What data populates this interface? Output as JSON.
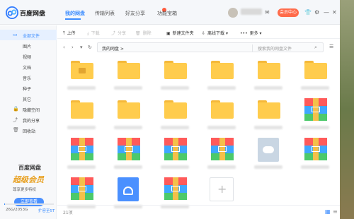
{
  "titlebar": {
    "brand": "百度网盘",
    "tabs": [
      {
        "label": "我的网盘",
        "active": true
      },
      {
        "label": "传输列表",
        "active": false
      },
      {
        "label": "好友分享",
        "active": false
      },
      {
        "label": "功能宝箱",
        "active": false
      }
    ],
    "member_button": "会员中心"
  },
  "sidebar": {
    "items": [
      {
        "label": "全部文件",
        "icon": "folder-icon",
        "active": true
      },
      {
        "label": "图片",
        "icon": "",
        "active": false
      },
      {
        "label": "视频",
        "icon": "",
        "active": false
      },
      {
        "label": "文档",
        "icon": "",
        "active": false
      },
      {
        "label": "音乐",
        "icon": "",
        "active": false
      },
      {
        "label": "种子",
        "icon": "",
        "active": false
      },
      {
        "label": "其它",
        "icon": "",
        "active": false
      },
      {
        "label": "隐藏空间",
        "icon": "lock-icon",
        "active": false
      },
      {
        "label": "我的分享",
        "icon": "share-icon",
        "active": false
      },
      {
        "label": "回收站",
        "icon": "trash-icon",
        "active": false
      }
    ],
    "promo": {
      "title": "百度网盘",
      "svip": "超级会员",
      "subtitle": "尊享更多特权",
      "button": "立即查看"
    },
    "storage": {
      "text": "26G/2053G",
      "used_fraction": 0.013,
      "expand": "扩容至5T"
    }
  },
  "toolbar": {
    "upload": "上传",
    "download": "下载",
    "share": "分享",
    "delete": "删除",
    "new_folder": "新建文件夹",
    "offline_download": "离线下载",
    "more": "更多"
  },
  "address": {
    "path": "我的网盘 >",
    "search_placeholder": "搜索我的网盘文件"
  },
  "grid": {
    "items": [
      {
        "type": "folder-locked"
      },
      {
        "type": "folder"
      },
      {
        "type": "folder"
      },
      {
        "type": "folder"
      },
      {
        "type": "folder"
      },
      {
        "type": "folder"
      },
      {
        "type": "folder"
      },
      {
        "type": "folder"
      },
      {
        "type": "folder"
      },
      {
        "type": "folder"
      },
      {
        "type": "folder"
      },
      {
        "type": "zip"
      },
      {
        "type": "zip"
      },
      {
        "type": "zip"
      },
      {
        "type": "zip"
      },
      {
        "type": "zip"
      },
      {
        "type": "cloud-doc"
      },
      {
        "type": "zip"
      },
      {
        "type": "zip"
      },
      {
        "type": "blue-doc"
      },
      {
        "type": "zip"
      },
      {
        "type": "add"
      }
    ]
  },
  "status": {
    "count": "21项"
  },
  "colors": {
    "accent": "#3b8cff",
    "folder": "#ffcc4d",
    "member": "#ff6b4a"
  }
}
